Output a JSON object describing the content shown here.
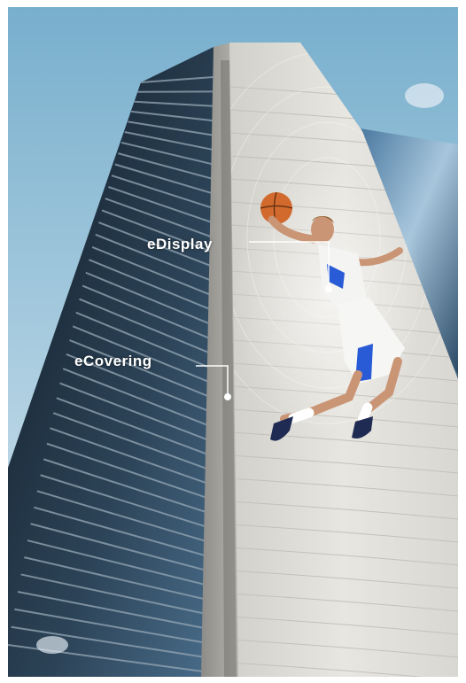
{
  "callouts": [
    {
      "id": "edisplay",
      "label": "eDisplay"
    },
    {
      "id": "ecovering",
      "label": "eCovering"
    }
  ],
  "colors": {
    "sky_top": "#7fb3d0",
    "sky_bottom": "#cfe2ee",
    "glass_dark": "#1d2b38",
    "facade_light": "#e4e2dc",
    "callout_line": "#ffffff",
    "jersey_accent": "#2a5bd7"
  }
}
